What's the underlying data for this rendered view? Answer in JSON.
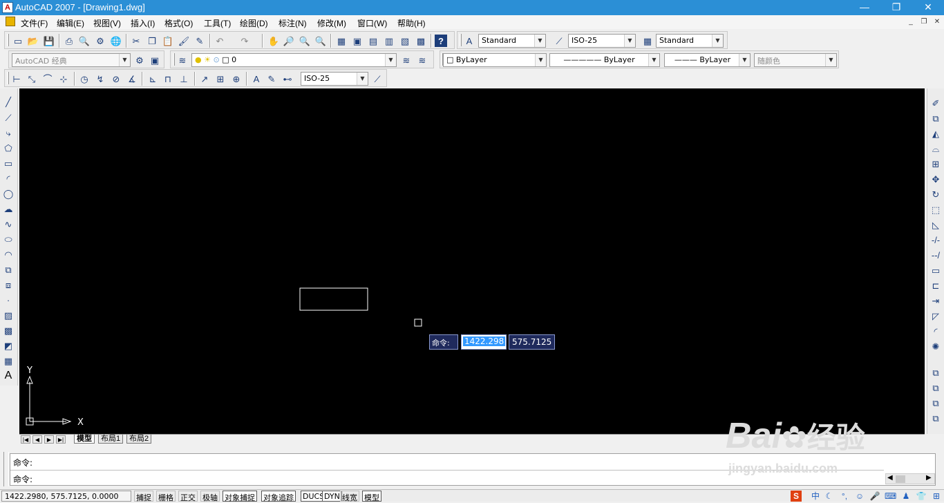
{
  "window": {
    "title": "AutoCAD 2007 - [Drawing1.dwg]",
    "minimize": "—",
    "restore": "❐",
    "close": "✕"
  },
  "menu": {
    "items": [
      "文件(F)",
      "编辑(E)",
      "视图(V)",
      "插入(I)",
      "格式(O)",
      "工具(T)",
      "绘图(D)",
      "标注(N)",
      "修改(M)",
      "窗口(W)",
      "帮助(H)"
    ],
    "doc_min": "_",
    "doc_restore": "❐",
    "doc_close": "✕"
  },
  "styles": {
    "text_style": "Standard",
    "dim_style": "ISO-25",
    "table_style": "Standard"
  },
  "workspace": {
    "value": "AutoCAD 经典"
  },
  "layers": {
    "current": "0"
  },
  "properties": {
    "color": "ByLayer",
    "linetype": "ByLayer",
    "lineweight": "ByLayer",
    "plot_style": "随颜色"
  },
  "dimension_toolbar": {
    "style": "ISO-25"
  },
  "canvas": {
    "background": "#000000",
    "ucs_x": "X",
    "ucs_y": "Y"
  },
  "dynamic_input": {
    "prompt": "命令:",
    "x_value": "1422.298",
    "y_value": "575.7125"
  },
  "layout_tabs": {
    "tabs": [
      "模型",
      "布局1",
      "布局2"
    ],
    "active": "模型"
  },
  "command_window": {
    "line1": "命令:",
    "line2": "命令:"
  },
  "status": {
    "coordinates": "1422.2980, 575.7125, 0.0000",
    "buttons": [
      "捕捉",
      "栅格",
      "正交",
      "极轴",
      "对象捕捉",
      "对象追踪",
      "DUCS",
      "DYN",
      "线宽",
      "模型"
    ],
    "on_buttons": [
      "对象捕捉",
      "对象追踪",
      "DUCS",
      "DYN",
      "模型"
    ]
  },
  "tray": {
    "ime": "S",
    "lang": "中"
  },
  "watermark": {
    "brand": "Bai",
    "brand2": "经验",
    "url": "jingyan.baidu.com"
  },
  "colors": {
    "title_bar": "#2b8fd6",
    "accent": "#1d3e7a"
  }
}
